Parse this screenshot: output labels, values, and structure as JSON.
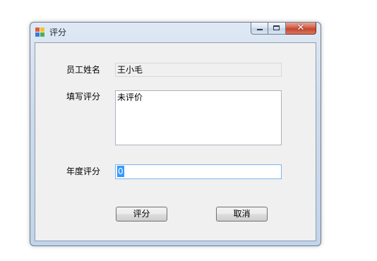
{
  "window": {
    "title": "评分",
    "close_glyph": "✕",
    "icons": {
      "app": "app-icon",
      "minimize": "minimize-icon",
      "maximize": "maximize-icon",
      "close": "close-icon"
    }
  },
  "form": {
    "name_label": "员工姓名",
    "name_value": "王小毛",
    "comment_label": "填写评分",
    "comment_value": "未评价",
    "score_label": "年度评分",
    "score_value": "0"
  },
  "buttons": {
    "rate_label": "评分",
    "cancel_label": "取消"
  }
}
